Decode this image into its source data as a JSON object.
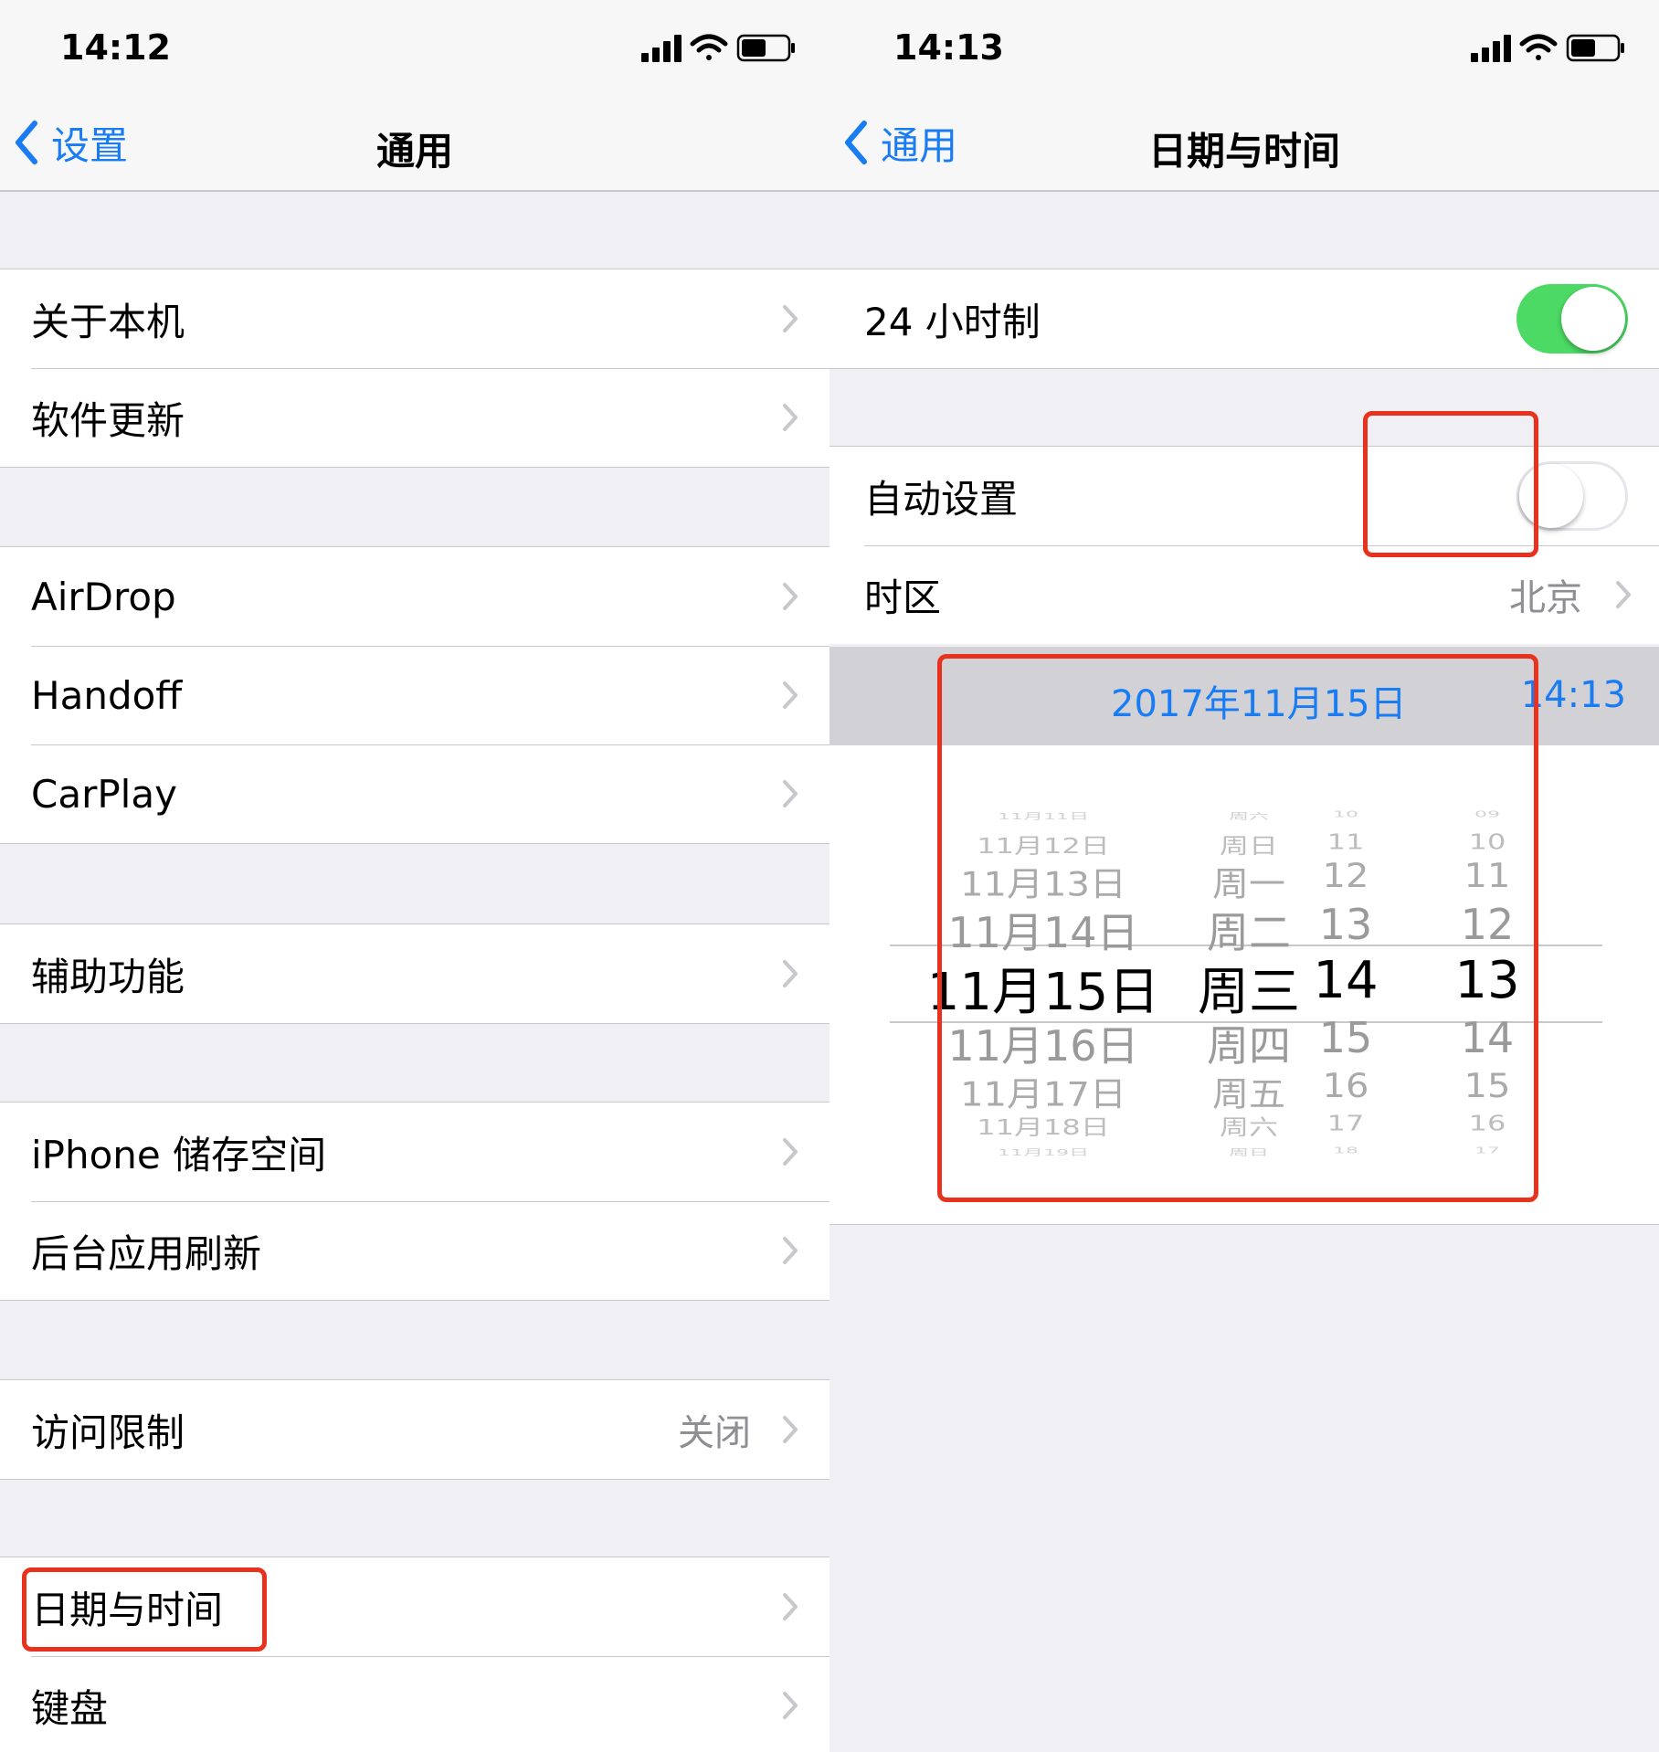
{
  "left": {
    "status_time": "14:12",
    "back_label": "设置",
    "title": "通用",
    "items": {
      "about": "关于本机",
      "software_update": "软件更新",
      "airdrop": "AirDrop",
      "handoff": "Handoff",
      "carplay": "CarPlay",
      "accessibility": "辅助功能",
      "storage": "iPhone 储存空间",
      "background_refresh": "后台应用刷新",
      "restrictions": "访问限制",
      "restrictions_value": "关闭",
      "date_time": "日期与时间",
      "keyboard": "键盘"
    }
  },
  "right": {
    "status_time": "14:13",
    "back_label": "通用",
    "title": "日期与时间",
    "hour24_label": "24 小时制",
    "hour24_on": true,
    "auto_label": "自动设置",
    "auto_on": false,
    "timezone_label": "时区",
    "timezone_value": "北京",
    "selected_date": "2017年11月15日",
    "selected_time": "14:13",
    "picker_rows": [
      {
        "date": "11月11日",
        "weekday": "周六",
        "hour": "10",
        "minute": "09"
      },
      {
        "date": "11月12日",
        "weekday": "周日",
        "hour": "11",
        "minute": "10"
      },
      {
        "date": "11月13日",
        "weekday": "周一",
        "hour": "12",
        "minute": "11"
      },
      {
        "date": "11月14日",
        "weekday": "周二",
        "hour": "13",
        "minute": "12"
      },
      {
        "date": "11月15日",
        "weekday": "周三",
        "hour": "14",
        "minute": "13"
      },
      {
        "date": "11月16日",
        "weekday": "周四",
        "hour": "15",
        "minute": "14"
      },
      {
        "date": "11月17日",
        "weekday": "周五",
        "hour": "16",
        "minute": "15"
      },
      {
        "date": "11月18日",
        "weekday": "周六",
        "hour": "17",
        "minute": "16"
      },
      {
        "date": "11月19日",
        "weekday": "周日",
        "hour": "18",
        "minute": "17"
      }
    ]
  },
  "colors": {
    "accent": "#1a7cf2",
    "toggle_on": "#4cd964",
    "highlight": "#e8321e",
    "background": "#efeff4",
    "secondary_text": "#8e8e93"
  }
}
